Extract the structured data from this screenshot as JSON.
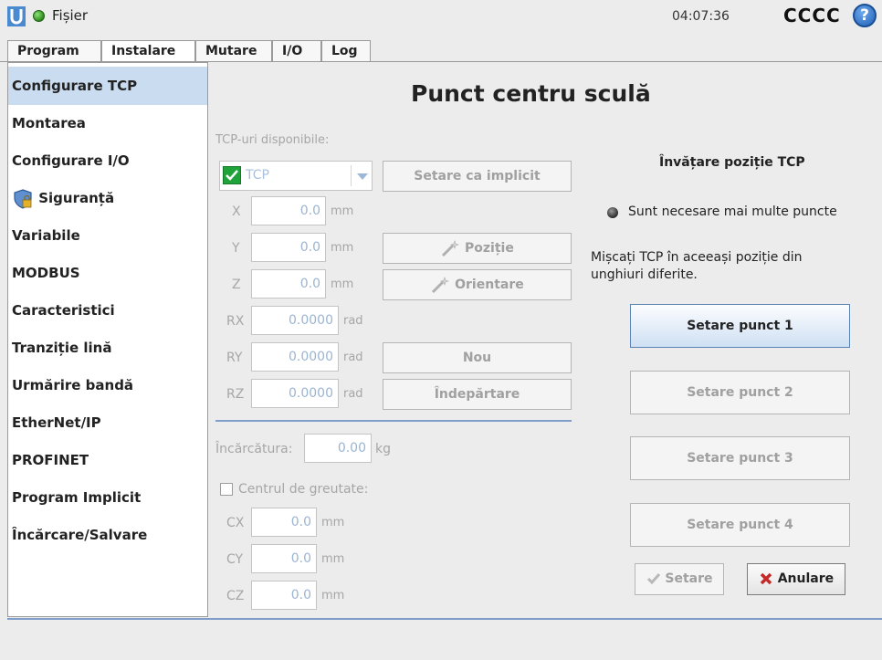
{
  "header": {
    "file_menu": "Fișier",
    "clock": "04:07:36",
    "robot_name": "CCCC",
    "help_label": "?"
  },
  "tabs": [
    "Program",
    "Instalare",
    "Mutare",
    "I/O",
    "Log"
  ],
  "active_tab": "Instalare",
  "sidebar": {
    "items": [
      "Configurare TCP",
      "Montarea",
      "Configurare I/O",
      "Siguranță",
      "Variabile",
      "MODBUS",
      "Caracteristici",
      "Tranziție lină",
      "Urmărire bandă",
      "EtherNet/IP",
      "PROFINET",
      "Program Implicit",
      "Încărcare/Salvare"
    ],
    "active_index": 0
  },
  "main": {
    "title": "Punct centru sculă",
    "available_tcps_label": "TCP-uri disponibile:",
    "tcp_selected": "TCP",
    "set_default_button": "Setare ca implicit",
    "coords": [
      {
        "label": "X",
        "value": "0.0",
        "unit": "mm"
      },
      {
        "label": "Y",
        "value": "0.0",
        "unit": "mm"
      },
      {
        "label": "Z",
        "value": "0.0",
        "unit": "mm"
      },
      {
        "label": "RX",
        "value": "0.0000",
        "unit": "rad"
      },
      {
        "label": "RY",
        "value": "0.0000",
        "unit": "rad"
      },
      {
        "label": "RZ",
        "value": "0.0000",
        "unit": "rad"
      }
    ],
    "position_button": "Poziție",
    "orientation_button": "Orientare",
    "new_button": "Nou",
    "remove_button": "Îndepărtare",
    "payload_label": "Încărcătura:",
    "payload_value": "0.00",
    "payload_unit": "kg",
    "cog_checkbox_label": "Centrul de greutate:",
    "cog_checked": false,
    "cog": [
      {
        "label": "CX",
        "value": "0.0",
        "unit": "mm"
      },
      {
        "label": "CY",
        "value": "0.0",
        "unit": "mm"
      },
      {
        "label": "CZ",
        "value": "0.0",
        "unit": "mm"
      }
    ]
  },
  "teach": {
    "title": "Învățare poziție TCP",
    "status": "Sunt necesare mai multe puncte",
    "instruction": "Mișcați TCP în aceeași poziție din unghiuri diferite.",
    "point_buttons": [
      "Setare punct 1",
      "Setare punct 2",
      "Setare punct 3",
      "Setare punct 4"
    ],
    "set_button": "Setare",
    "cancel_button": "Anulare"
  },
  "colors": {
    "accent": "#7e9dc8",
    "sidebar_active": "#c9dcf0",
    "status_ok": "#2d8a1c",
    "tcp_icon": "#1fa23a",
    "cancel_red": "#c62828"
  }
}
